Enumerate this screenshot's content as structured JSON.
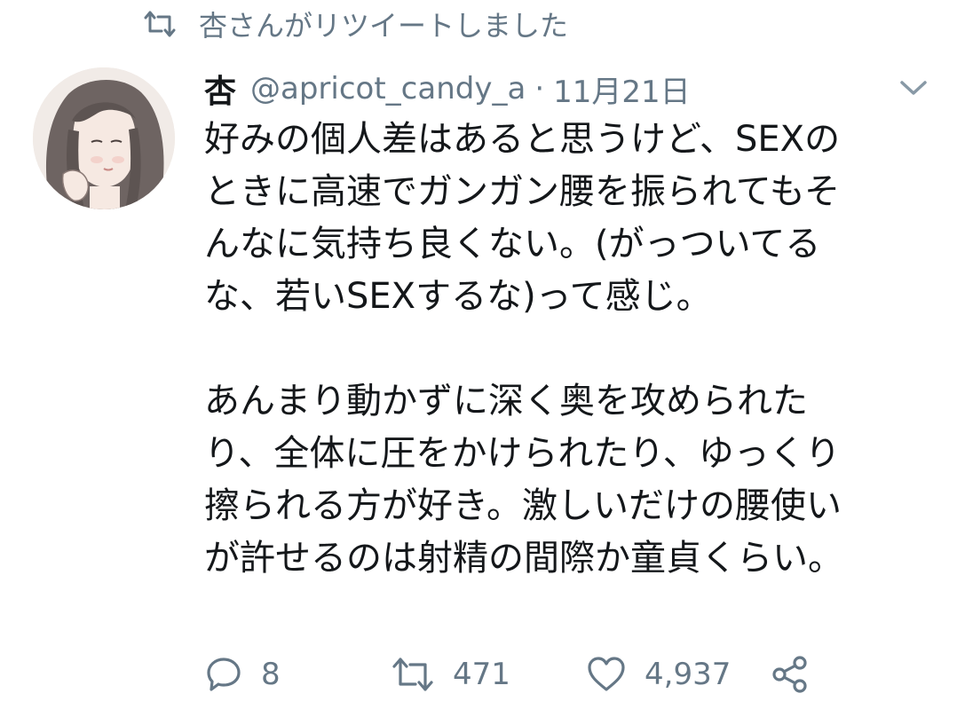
{
  "retweet_context": {
    "text": "杏さんがリツイートしました",
    "icon": "retweet-icon"
  },
  "author": {
    "display_name": "杏",
    "handle": "@apricot_candy_a",
    "separator": "·",
    "date": "11月21日",
    "avatar": "avatar-illustration"
  },
  "tweet": {
    "lines": [
      "好みの個人差はあると思うけど、SEXの",
      "ときに高速でガンガン腰を振られてもそ",
      "んなに気持ち良くない。(がっついてる",
      "な、若いSEXするな)って感じ。",
      "",
      "あんまり動かずに深く奥を攻められた",
      "り、全体に圧をかけられたり、ゆっくり",
      "擦られる方が好き。激しいだけの腰使い",
      "が許せるのは射精の間際か童貞くらい。"
    ]
  },
  "actions": {
    "reply_count": "8",
    "retweet_count": "471",
    "like_count": "4,937",
    "icons": [
      "reply-icon",
      "retweet-icon",
      "heart-icon",
      "share-icon"
    ]
  },
  "colors": {
    "text": "#14171a",
    "muted": "#657786",
    "background": "#ffffff"
  }
}
